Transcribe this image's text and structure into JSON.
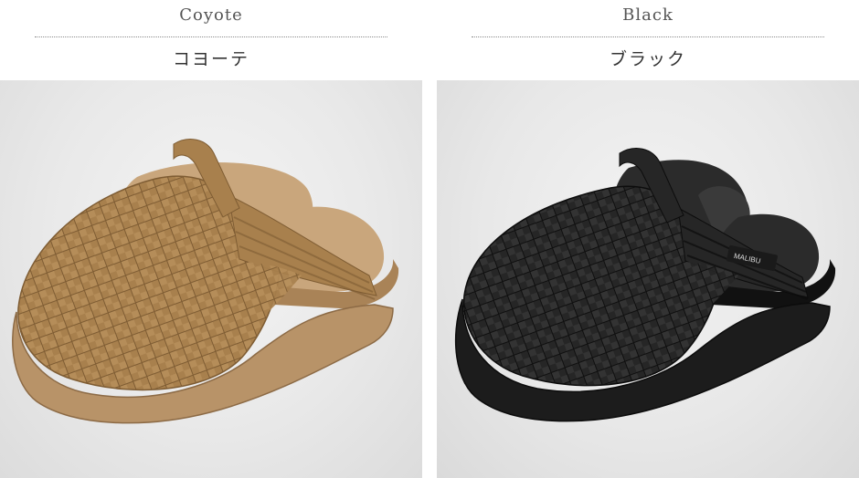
{
  "variants": [
    {
      "name_en": "Coyote",
      "name_ja": "コヨーテ",
      "colors": {
        "upper": "#a8804d",
        "upper_dark": "#7e5c33",
        "upper_light": "#c19a66",
        "sole": "#b89368",
        "sole_top": "#c9a67c",
        "sole_dark": "#8c6a45"
      }
    },
    {
      "name_en": "Black",
      "name_ja": "ブラック",
      "label_text": "MALIBU",
      "colors": {
        "upper": "#262626",
        "upper_dark": "#111111",
        "upper_light": "#3c3c3c",
        "sole": "#1c1c1c",
        "sole_top": "#2b2b2b",
        "sole_dark": "#0c0c0c"
      }
    }
  ]
}
